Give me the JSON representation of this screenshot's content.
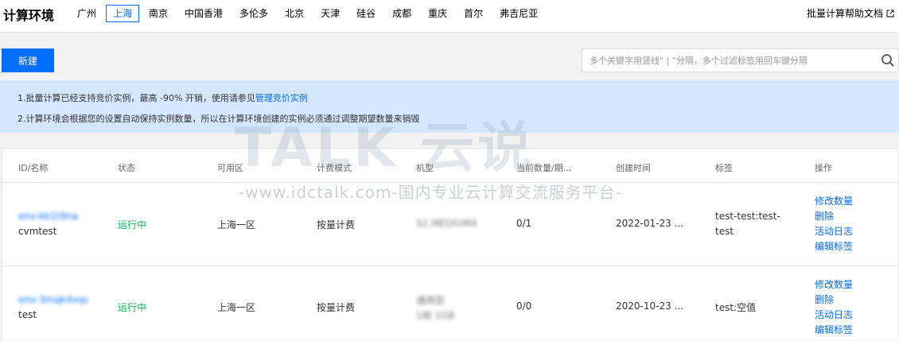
{
  "header": {
    "title": "计算环境",
    "regions": [
      "广州",
      "上海",
      "南京",
      "中国香港",
      "多伦多",
      "北京",
      "天津",
      "硅谷",
      "成都",
      "重庆",
      "首尔",
      "弗吉尼亚"
    ],
    "active_region": "上海",
    "help_link": "批量计算帮助文档"
  },
  "toolbar": {
    "new_button": "新建",
    "search_placeholder": "多个关键字用竖线\" | \"分隔，多个过滤标签用回车键分隔"
  },
  "notice": {
    "line1_prefix": "1.批量计算已经支持竞价实例，最高 -90% 开销，使用请参见",
    "line1_link": "管理竞价实例",
    "line2": "2.计算环境会根据您的设置自动保持实例数量，所以在计算环境创建的实例必须通过调整期望数量来销毁"
  },
  "table": {
    "columns": [
      "ID/名称",
      "状态",
      "可用区",
      "计费模式",
      "机型",
      "当前数量/期...",
      "创建时间",
      "标签",
      "操作"
    ],
    "rows": [
      {
        "id": "env-kk1t9na",
        "name": "cvmtest",
        "status": "运行中",
        "zone": "上海一区",
        "billing": "按量计费",
        "model_line1": "S2.MEDIUM4",
        "model_line2": "",
        "count": "0/1",
        "created": "2022-01-23 ...",
        "tag_line1": "test-test:test-",
        "tag_line2": "test",
        "ops": [
          "修改数量",
          "删除",
          "活动日志",
          "编辑标签"
        ]
      },
      {
        "id": "env-3mqk4xqc",
        "name": "test",
        "status": "运行中",
        "zone": "上海一区",
        "billing": "按量计费",
        "model_line1": "通用型",
        "model_line2": "1核 1GB",
        "count": "0/0",
        "created": "2020-10-23 ...",
        "tag_line1": "test:空值",
        "tag_line2": "",
        "ops": [
          "修改数量",
          "删除",
          "活动日志",
          "编辑标签"
        ]
      }
    ]
  },
  "watermark": {
    "main": "TALK 云说",
    "sub": "-www.idctalk.com-国内专业云计算交流服务平台-"
  }
}
